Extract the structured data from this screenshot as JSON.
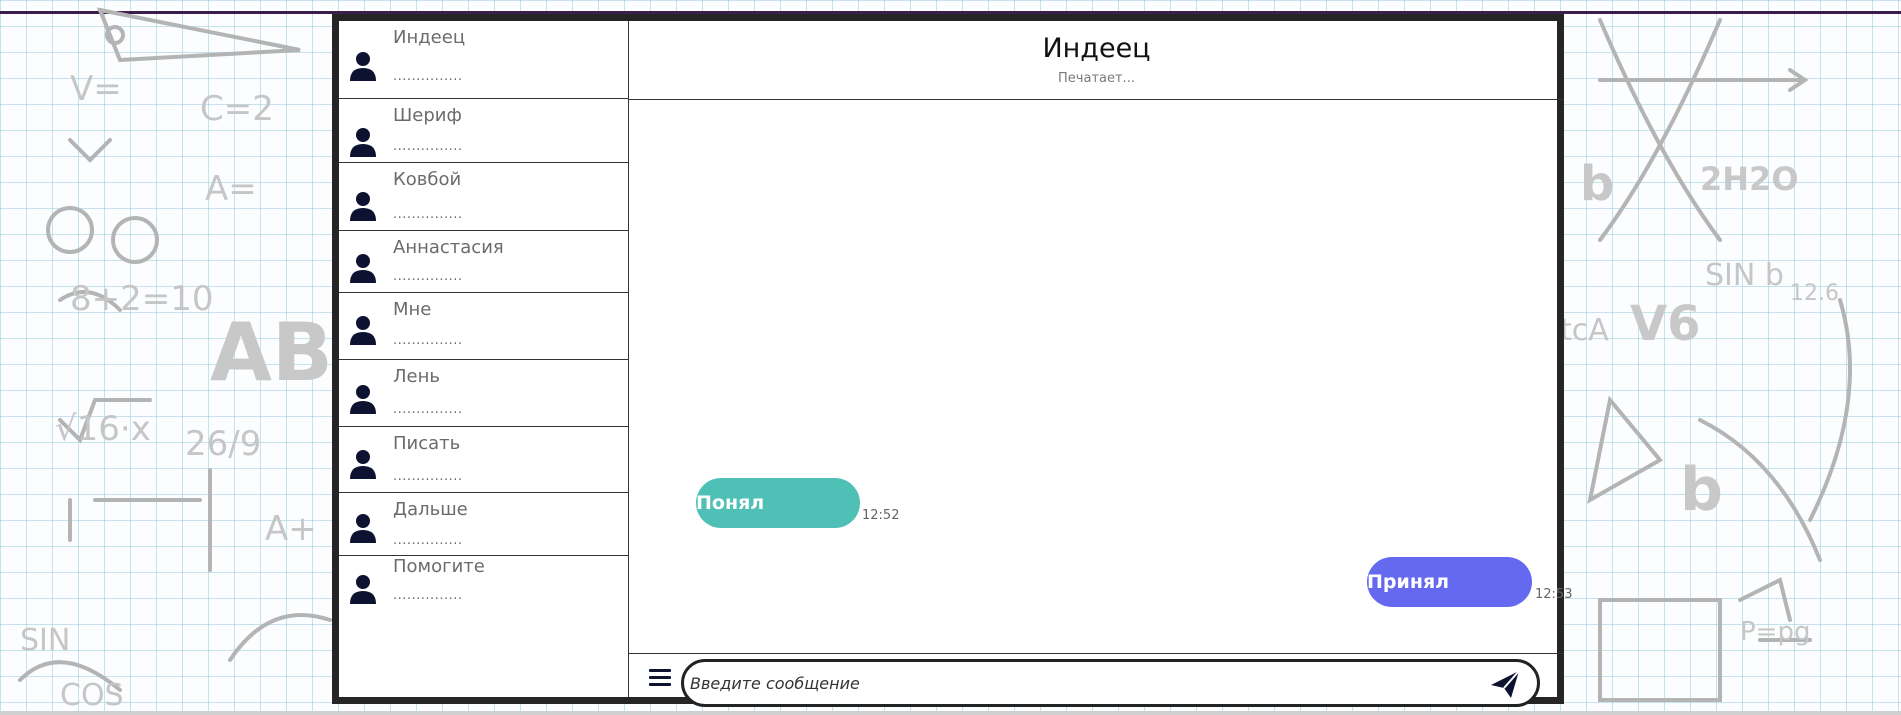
{
  "theme": {
    "avatar_color": "#0c1230",
    "incoming_bubble": "#4fc0b5",
    "outgoing_bubble": "#6469f0"
  },
  "contacts": [
    {
      "name": "Индеец",
      "preview": "..............."
    },
    {
      "name": "Шериф",
      "preview": "..............."
    },
    {
      "name": "Ковбой",
      "preview": "..............."
    },
    {
      "name": "Аннастасия",
      "preview": "..............."
    },
    {
      "name": "Мне",
      "preview": "..............."
    },
    {
      "name": "Лень",
      "preview": "..............."
    },
    {
      "name": "Писать",
      "preview": "..............."
    },
    {
      "name": "Дальше",
      "preview": "..............."
    },
    {
      "name": "Помогите",
      "preview": "..............."
    }
  ],
  "chat": {
    "title": "Индеец",
    "status": "Печатает..."
  },
  "messages": [
    {
      "text": "Понял",
      "time": "12:52",
      "direction": "incoming"
    },
    {
      "text": "Принял",
      "time": "12:53",
      "direction": "outgoing"
    }
  ],
  "composer": {
    "placeholder": "Введите сообщение",
    "menu_icon": "menu-icon",
    "send_icon": "send-icon"
  }
}
